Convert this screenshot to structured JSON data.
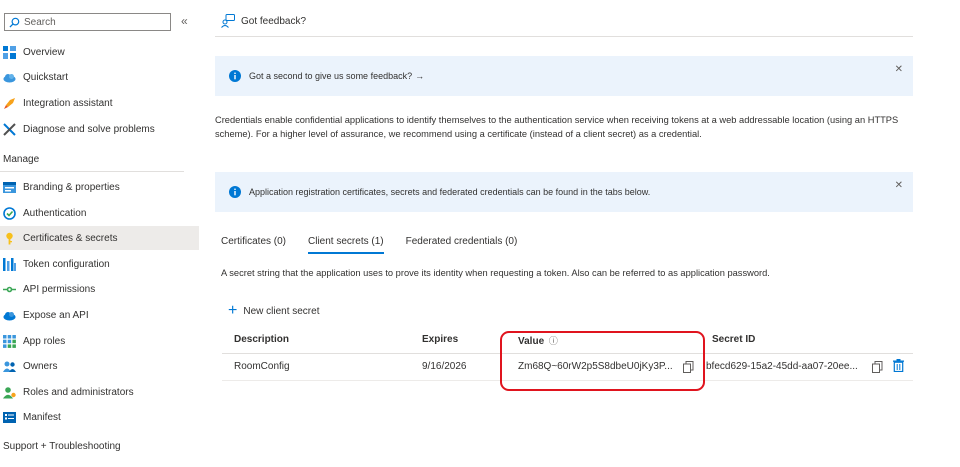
{
  "sidebar": {
    "search_placeholder": "Search",
    "collapse_glyph": "«",
    "items_top": [
      {
        "label": "Overview",
        "icon": "overview-grid-icon"
      },
      {
        "label": "Quickstart",
        "icon": "quickstart-cloud-icon"
      },
      {
        "label": "Integration assistant",
        "icon": "rocket-icon"
      },
      {
        "label": "Diagnose and solve problems",
        "icon": "wrench-icon"
      }
    ],
    "manage_header": "Manage",
    "items_manage": [
      {
        "label": "Branding & properties",
        "icon": "branding-icon"
      },
      {
        "label": "Authentication",
        "icon": "authentication-icon"
      },
      {
        "label": "Certificates & secrets",
        "icon": "key-icon",
        "active": true
      },
      {
        "label": "Token configuration",
        "icon": "token-bars-icon"
      },
      {
        "label": "API permissions",
        "icon": "api-permissions-icon"
      },
      {
        "label": "Expose an API",
        "icon": "cloud-api-icon"
      },
      {
        "label": "App roles",
        "icon": "app-roles-grid-icon"
      },
      {
        "label": "Owners",
        "icon": "owners-people-icon"
      },
      {
        "label": "Roles and administrators",
        "icon": "roles-person-icon"
      },
      {
        "label": "Manifest",
        "icon": "manifest-icon"
      }
    ],
    "support_header": "Support + Troubleshooting"
  },
  "main": {
    "feedback_link": "Got feedback?",
    "feedback_banner": "Got a second to give us some feedback?",
    "feedback_arrow": "→",
    "close_glyph": "✕",
    "description": "Credentials enable confidential applications to identify themselves to the authentication service when receiving tokens at a web addressable location (using an HTTPS scheme). For a higher level of assurance, we recommend using a certificate (instead of a client secret) as a credential.",
    "info_banner": "Application registration certificates, secrets and federated credentials can be found in the tabs below.",
    "tabs": [
      {
        "label": "Certificates (0)"
      },
      {
        "label": "Client secrets (1)",
        "active": true
      },
      {
        "label": "Federated credentials (0)"
      }
    ],
    "secret_description": "A secret string that the application uses to prove its identity when requesting a token. Also can be referred to as application password.",
    "new_secret_label": "New client secret",
    "new_secret_glyph": "+",
    "table": {
      "headers": {
        "description": "Description",
        "expires": "Expires",
        "value": "Value",
        "value_info_glyph": "ⓘ",
        "secret_id": "Secret ID"
      },
      "rows": [
        {
          "description": "RoomConfig",
          "expires": "9/16/2026",
          "value": "Zm68Q~60rW2p5S8dbeU0jKy3P...",
          "secret_id": "bfecd629-15a2-45dd-aa07-20ee..."
        }
      ]
    }
  },
  "colors": {
    "accent": "#0078d4",
    "banner_bg": "#ebf3fc",
    "highlight": "#e0141e",
    "active_nav_bg": "#edebe9"
  }
}
